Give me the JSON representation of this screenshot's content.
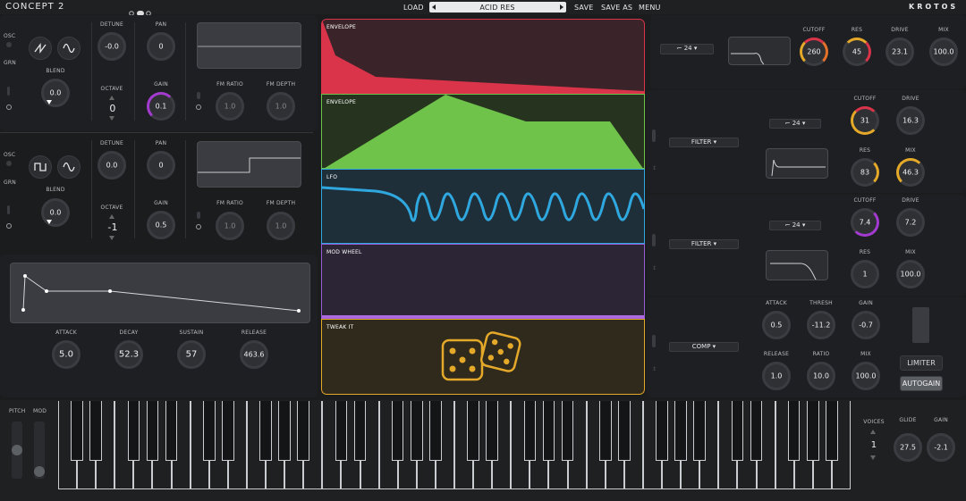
{
  "header": {
    "logo": "CONCEPT 2",
    "load": "LOAD",
    "preset": "ACID RES",
    "save": "SAVE",
    "save_as": "SAVE AS",
    "menu": "MENU",
    "brand": "KROTOS"
  },
  "osc1": {
    "osc_label": "OSC",
    "grn_label": "GRN",
    "blend_label": "BLEND",
    "blend": "0.0",
    "detune_label": "DETUNE",
    "detune": "-0.0",
    "octave_label": "OCTAVE",
    "octave": "0",
    "pan_label": "PAN",
    "pan": "0",
    "gain_label": "GAIN",
    "gain": "0.1",
    "fm_ratio_label": "FM RATIO",
    "fm_ratio": "1.0",
    "fm_depth_label": "FM DEPTH",
    "fm_depth": "1.0"
  },
  "osc2": {
    "osc_label": "OSC",
    "grn_label": "GRN",
    "blend_label": "BLEND",
    "blend": "0.0",
    "detune_label": "DETUNE",
    "detune": "0.0",
    "octave_label": "OCTAVE",
    "octave": "-1",
    "pan_label": "PAN",
    "pan": "0",
    "gain_label": "GAIN",
    "gain": "0.5",
    "fm_ratio_label": "FM RATIO",
    "fm_ratio": "1.0",
    "fm_depth_label": "FM DEPTH",
    "fm_depth": "1.0"
  },
  "amp_env": {
    "attack_label": "ATTACK",
    "attack": "5.0",
    "decay_label": "DECAY",
    "decay": "52.3",
    "sustain_label": "SUSTAIN",
    "sustain": "57",
    "release_label": "RELEASE",
    "release": "463.6"
  },
  "mod": {
    "env1": "ENVELOPE",
    "env2": "ENVELOPE",
    "lfo": "LFO",
    "modwheel": "MOD WHEEL",
    "tweak": "TWEAK IT"
  },
  "filter1": {
    "slope": "24",
    "cutoff_label": "CUTOFF",
    "cutoff": "260",
    "res_label": "RES",
    "res": "45",
    "drive_label": "DRIVE",
    "drive": "23.1",
    "mix_label": "MIX",
    "mix": "100.0"
  },
  "filter2": {
    "type": "FILTER",
    "slope": "24",
    "cutoff_label": "CUTOFF",
    "cutoff": "31",
    "drive_label": "DRIVE",
    "drive": "16.3",
    "res_label": "RES",
    "res": "83",
    "mix_label": "MIX",
    "mix": "46.3"
  },
  "filter3": {
    "type": "FILTER",
    "slope": "24",
    "cutoff_label": "CUTOFF",
    "cutoff": "7.4",
    "drive_label": "DRIVE",
    "drive": "7.2",
    "res_label": "RES",
    "res": "1",
    "mix_label": "MIX",
    "mix": "100.0"
  },
  "comp": {
    "type": "COMP",
    "attack_label": "ATTACK",
    "attack": "0.5",
    "thresh_label": "THRESH",
    "thresh": "-11.2",
    "gain_label": "GAIN",
    "gain": "-0.7",
    "release_label": "RELEASE",
    "release": "1.0",
    "ratio_label": "RATIO",
    "ratio": "10.0",
    "mix_label": "MIX",
    "mix": "100.0",
    "limiter": "LIMITER",
    "autogain": "AUTOGAIN"
  },
  "keyboard": {
    "pitch_label": "PITCH",
    "mod_label": "MOD",
    "voices_label": "VOICES",
    "voices": "1",
    "glide_label": "GLIDE",
    "glide": "27.5",
    "gain_label": "GAIN",
    "gain": "-2.1"
  },
  "colors": {
    "env1": "#d9344a",
    "env2": "#6fc24a",
    "lfo": "#2fa8e0",
    "modwheel": "#9a5bd6",
    "tweak": "#e5a92a"
  }
}
